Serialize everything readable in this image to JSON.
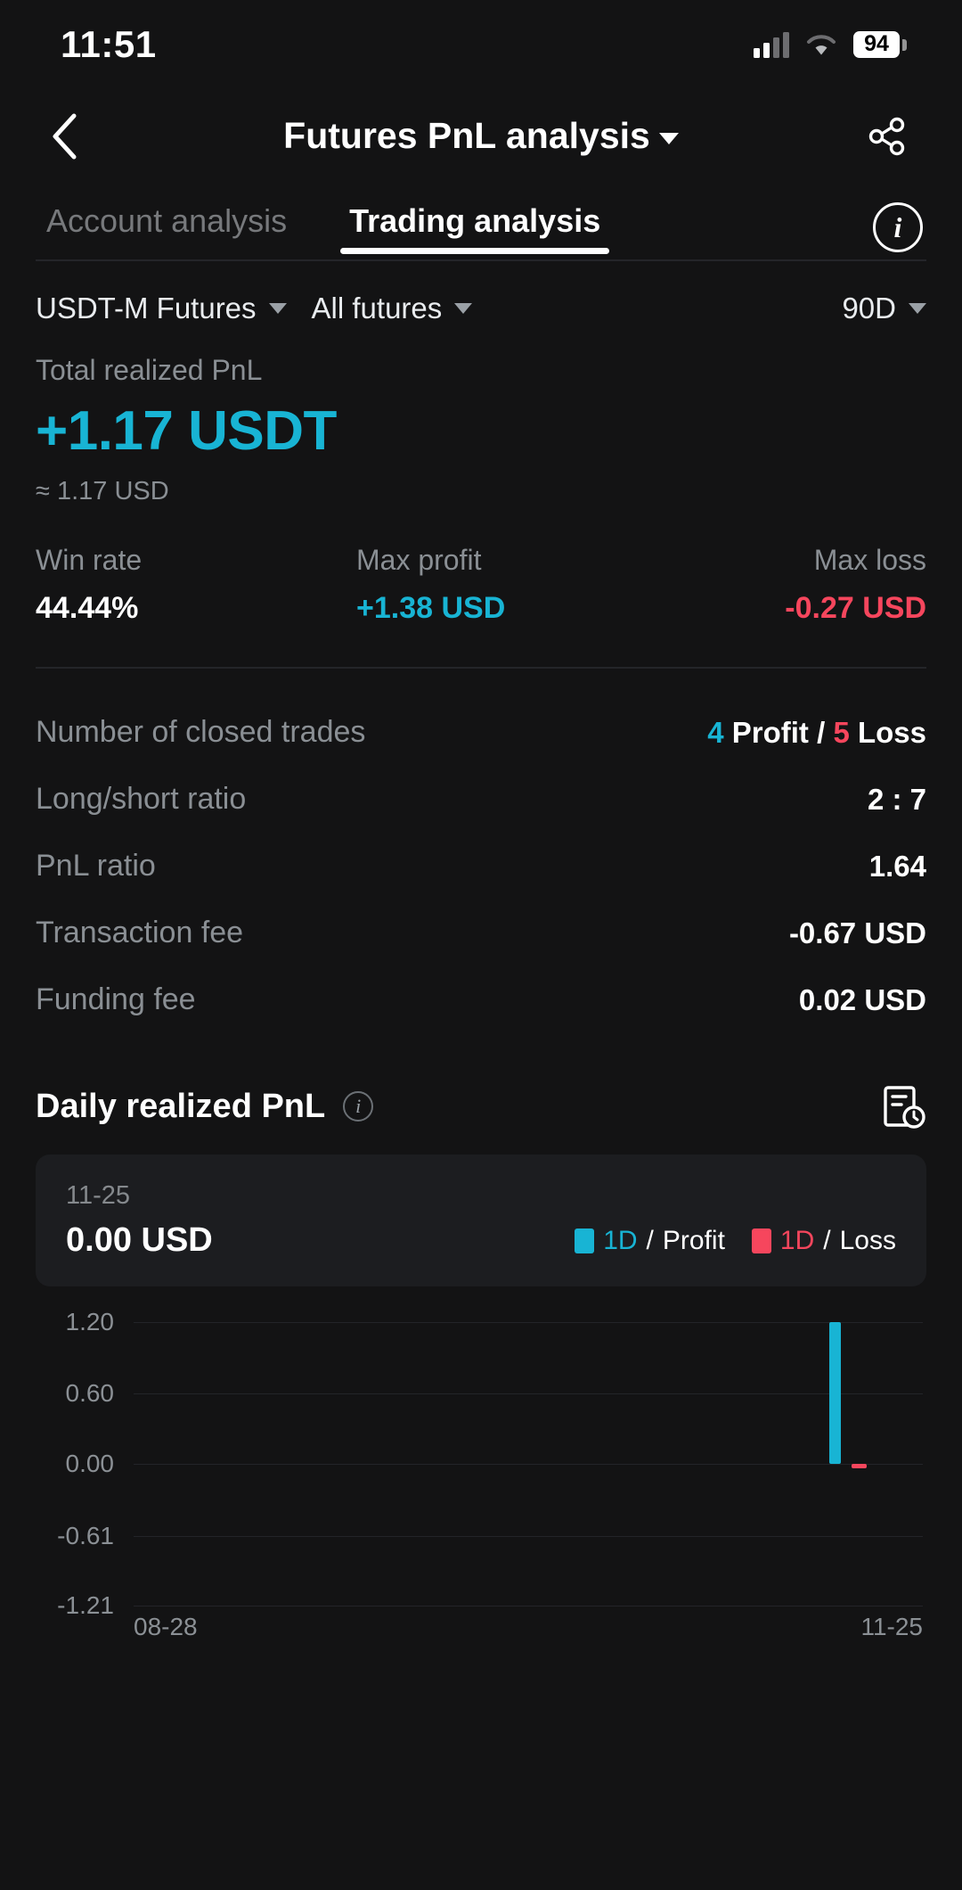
{
  "status_bar": {
    "time": "11:51",
    "battery_level": "94",
    "signal_icon": "cellular-bars-icon",
    "wifi_icon": "wifi-icon"
  },
  "header": {
    "back_icon": "back-chevron-icon",
    "title": "Futures PnL analysis",
    "title_caret": "chevron-down-icon",
    "share_icon": "share-icon"
  },
  "tabs": {
    "items": [
      {
        "label": "Account analysis",
        "active": false
      },
      {
        "label": "Trading analysis",
        "active": true
      }
    ],
    "info_icon": "info-icon"
  },
  "filters": {
    "product": "USDT-M Futures",
    "contract": "All futures",
    "period": "90D"
  },
  "summary": {
    "total_label": "Total realized PnL",
    "total_value": "+1.17 USDT",
    "total_approx": "≈ 1.17 USD",
    "stats": [
      {
        "label": "Win rate",
        "value": "44.44%",
        "tone": "neutral"
      },
      {
        "label": "Max profit",
        "value": "+1.38 USD",
        "tone": "profit"
      },
      {
        "label": "Max loss",
        "value": "-0.27 USD",
        "tone": "loss"
      }
    ]
  },
  "details": {
    "closed_trades_label": "Number of closed trades",
    "closed_trades_profit": "4",
    "closed_trades_profit_suffix": "Profit",
    "closed_trades_sep": "/",
    "closed_trades_loss": "5",
    "closed_trades_loss_suffix": "Loss",
    "rows": [
      {
        "label": "Long/short ratio",
        "value": "2 : 7"
      },
      {
        "label": "PnL ratio",
        "value": "1.64"
      },
      {
        "label": "Transaction fee",
        "value": "-0.67 USD"
      },
      {
        "label": "Funding fee",
        "value": "0.02 USD"
      }
    ]
  },
  "daily_section": {
    "title": "Daily realized PnL",
    "info_icon": "info-icon",
    "record_icon": "history-record-icon",
    "tooltip": {
      "date": "11-25",
      "value": "0.00 USD"
    },
    "legend": [
      {
        "swatch": "profit",
        "period": "1D",
        "sep": "/",
        "label": "Profit"
      },
      {
        "swatch": "loss",
        "period": "1D",
        "sep": "/",
        "label": "Loss"
      }
    ]
  },
  "colors": {
    "profit": "#18b4d4",
    "loss": "#f6465d",
    "background": "#131314",
    "card": "#1c1d20",
    "text_primary": "#ffffff",
    "text_muted": "#8a8f94",
    "grid": "#232428"
  },
  "chart_data": {
    "type": "bar",
    "title": "Daily realized PnL",
    "xlabel": "",
    "ylabel": "",
    "grid": true,
    "legend_position": "top-right",
    "ylim": [
      -1.21,
      1.2
    ],
    "yticks": [
      "1.20",
      "0.60",
      "0.00",
      "-0.61",
      "-1.21"
    ],
    "ytick_values": [
      1.2,
      0.6,
      0,
      -0.61,
      -1.21
    ],
    "x_range": [
      "08-28",
      "11-25"
    ],
    "xticks": [
      "08-28",
      "11-25"
    ],
    "series": [
      {
        "name": "1D / Profit",
        "color": "#18b4d4",
        "points": [
          {
            "x": "11-24",
            "y": 1.2
          }
        ]
      },
      {
        "name": "1D / Loss",
        "color": "#f6465d",
        "points": [
          {
            "x": "11-25",
            "y": -0.04
          }
        ]
      }
    ]
  }
}
